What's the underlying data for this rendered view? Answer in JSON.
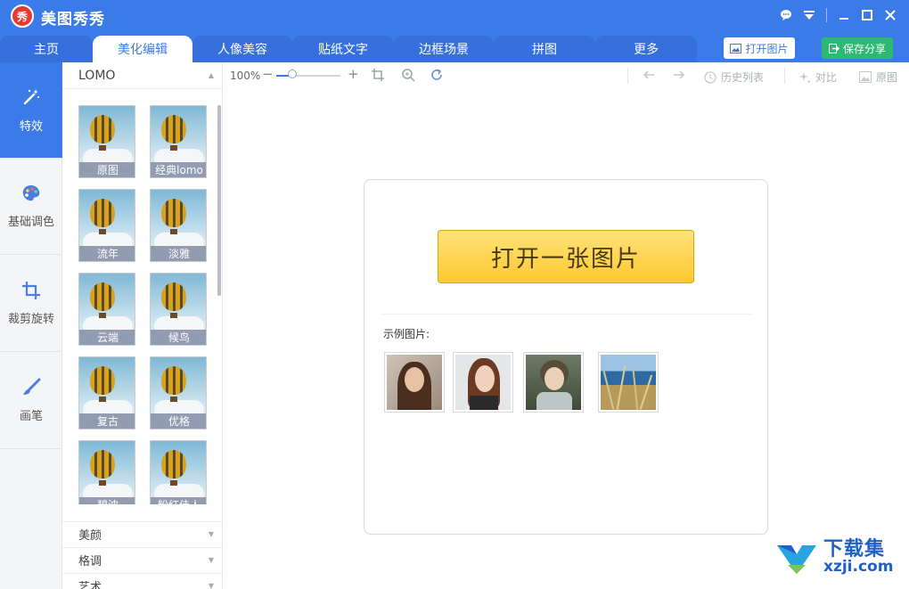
{
  "app": {
    "logo_text": "秀",
    "title": "美图秀秀"
  },
  "tabs": [
    "主页",
    "美化编辑",
    "人像美容",
    "贴纸文字",
    "边框场景",
    "拼图",
    "更多"
  ],
  "header_buttons": {
    "open": "打开图片",
    "save": "保存分享"
  },
  "leftnav": [
    "特效",
    "基础调色",
    "裁剪旋转",
    "画笔"
  ],
  "panel": {
    "heading": "LOMO",
    "thumbs": [
      "原图",
      "经典lomo",
      "流年",
      "淡雅",
      "云端",
      "候鸟",
      "复古",
      "优格",
      "碧波",
      "粉红佳人"
    ],
    "categories": [
      "美颜",
      "格调",
      "艺术"
    ]
  },
  "toolbar": {
    "zoom": "100%",
    "zoom_level": 0.25,
    "history": "历史列表",
    "compare": "对比",
    "original": "原图"
  },
  "canvas": {
    "open_button": "打开一张图片",
    "sample_label": "示例图片:"
  },
  "watermark": {
    "title": "下载集",
    "sub": "xzji.com"
  },
  "colors": {
    "brand": "#3b7be8",
    "save_green": "#2eb872",
    "open_gold": "#fdc92e"
  }
}
